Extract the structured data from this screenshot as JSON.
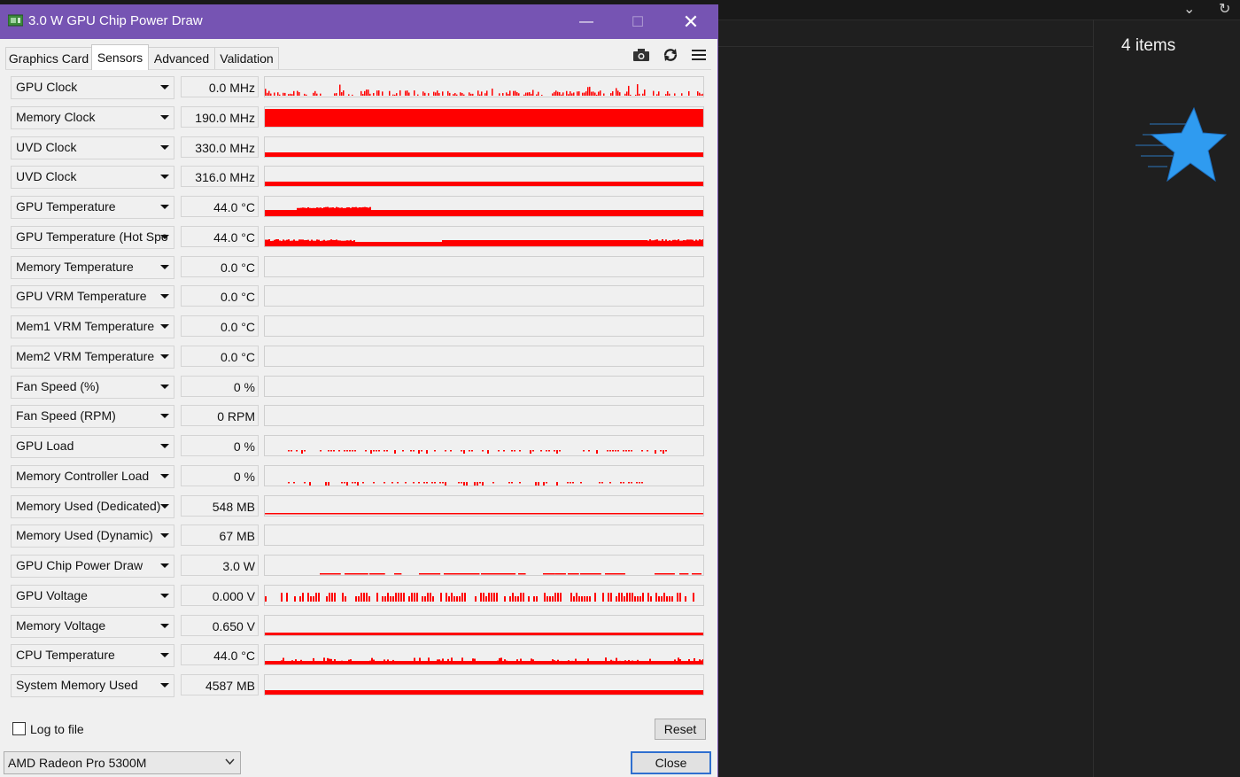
{
  "window": {
    "title": "3.0 W GPU Chip Power Draw"
  },
  "tabs": [
    "Graphics Card",
    "Sensors",
    "Advanced",
    "Validation"
  ],
  "active_tab": "Sensors",
  "colors": {
    "titlebar": "#7654b3",
    "graph": "#ff0000",
    "accent": "#2f6fcf"
  },
  "toolbar_icons": [
    "camera-icon",
    "refresh-icon",
    "menu-icon"
  ],
  "sensors": [
    {
      "name": "GPU Clock",
      "value": "0.0 MHz",
      "graph": "spiky-low"
    },
    {
      "name": "Memory Clock",
      "value": "190.0 MHz",
      "graph": "full"
    },
    {
      "name": "UVD Clock",
      "value": "330.0 MHz",
      "graph": "bar-low"
    },
    {
      "name": "UVD Clock",
      "value": "316.0 MHz",
      "graph": "bar-low"
    },
    {
      "name": "GPU Temperature",
      "value": "44.0 °C",
      "graph": "temp"
    },
    {
      "name": "GPU Temperature (Hot Spot)",
      "value": "44.0 °C",
      "graph": "temp2"
    },
    {
      "name": "Memory Temperature",
      "value": "0.0 °C",
      "graph": "empty"
    },
    {
      "name": "GPU VRM Temperature",
      "value": "0.0 °C",
      "graph": "empty"
    },
    {
      "name": "Mem1 VRM Temperature",
      "value": "0.0 °C",
      "graph": "empty"
    },
    {
      "name": "Mem2 VRM Temperature",
      "value": "0.0 °C",
      "graph": "empty"
    },
    {
      "name": "Fan Speed (%)",
      "value": "0 %",
      "graph": "empty"
    },
    {
      "name": "Fan Speed (RPM)",
      "value": "0 RPM",
      "graph": "empty"
    },
    {
      "name": "GPU Load",
      "value": "0 %",
      "graph": "dashes"
    },
    {
      "name": "Memory Controller Load",
      "value": "0 %",
      "graph": "dashes2"
    },
    {
      "name": "Memory Used (Dedicated)",
      "value": "548 MB",
      "graph": "thin-line"
    },
    {
      "name": "Memory Used (Dynamic)",
      "value": "67 MB",
      "graph": "empty"
    },
    {
      "name": "GPU Chip Power Draw",
      "value": "3.0 W",
      "graph": "power"
    },
    {
      "name": "GPU Voltage",
      "value": "0.000 V",
      "graph": "voltage"
    },
    {
      "name": "Memory Voltage",
      "value": "0.650 V",
      "graph": "thin-bar"
    },
    {
      "name": "CPU Temperature",
      "value": "44.0 °C",
      "graph": "cpu-temp"
    },
    {
      "name": "System Memory Used",
      "value": "4587 MB",
      "graph": "bar-low"
    }
  ],
  "footer": {
    "log_label": "Log to file",
    "log_checked": false,
    "reset_label": "Reset",
    "card_name": "AMD Radeon Pro 5300M",
    "close_label": "Close"
  },
  "explorer": {
    "status": "4 items"
  }
}
